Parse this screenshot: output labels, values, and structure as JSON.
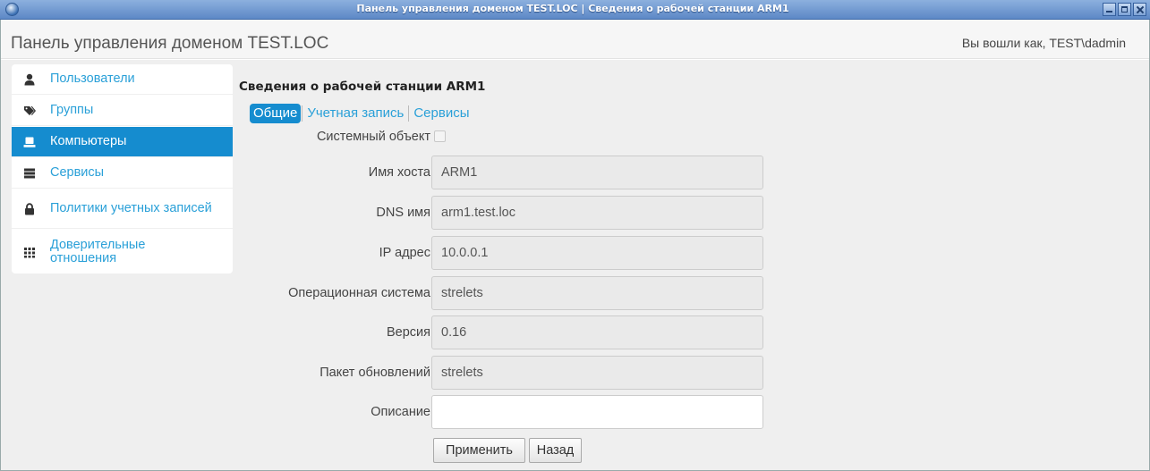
{
  "window": {
    "title": "Панель управления доменом TEST.LOC | Сведения о рабочей станции ARM1"
  },
  "header": {
    "app_title": "Панель управления доменом TEST.LOC",
    "login_info": "Вы вошли как, TEST\\dadmin"
  },
  "sidebar": {
    "items": [
      {
        "label": "Пользователи",
        "icon": "user-icon",
        "active": false
      },
      {
        "label": "Группы",
        "icon": "tags-icon",
        "active": false
      },
      {
        "label": "Компьютеры",
        "icon": "computer-icon",
        "active": true
      },
      {
        "label": "Сервисы",
        "icon": "server-icon",
        "active": false
      },
      {
        "label": "Политики учетных записей",
        "icon": "lock-icon",
        "active": false
      },
      {
        "label": "Доверительные отношения",
        "icon": "grid-icon",
        "active": false
      }
    ]
  },
  "main": {
    "title": "Сведения о рабочей станции ARM1",
    "tabs": [
      {
        "label": "Общие",
        "active": true
      },
      {
        "label": "Учетная запись",
        "active": false
      },
      {
        "label": "Сервисы",
        "active": false
      }
    ],
    "system_object": {
      "label": "Системный объект",
      "checked": false
    },
    "fields": [
      {
        "label": "Имя хоста",
        "value": "ARM1"
      },
      {
        "label": "DNS имя",
        "value": "arm1.test.loc"
      },
      {
        "label": "IP адрес",
        "value": "10.0.0.1"
      },
      {
        "label": "Операционная система",
        "value": "strelets"
      },
      {
        "label": "Версия",
        "value": "0.16"
      },
      {
        "label": "Пакет обновлений",
        "value": "strelets"
      }
    ],
    "description": {
      "label": "Описание",
      "value": ""
    },
    "buttons": {
      "apply": "Применить",
      "back": "Назад"
    }
  },
  "colors": {
    "accent": "#158ccf",
    "link": "#2aa0d8",
    "titlebar": "#5d88c6",
    "background": "#efefef"
  }
}
